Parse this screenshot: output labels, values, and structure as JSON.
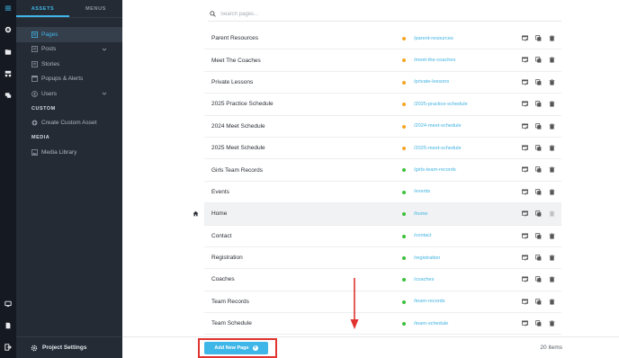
{
  "sidebar": {
    "tabs": [
      {
        "label": "ASSETS"
      },
      {
        "label": "MENUS"
      }
    ],
    "items": [
      {
        "label": "Pages"
      },
      {
        "label": "Posts"
      },
      {
        "label": "Stories"
      },
      {
        "label": "Popups & Alerts"
      },
      {
        "label": "Users"
      }
    ],
    "custom_header": "CUSTOM",
    "custom_items": [
      {
        "label": "Create Custom Asset"
      }
    ],
    "media_header": "MEDIA",
    "media_items": [
      {
        "label": "Media Library"
      }
    ],
    "footer_label": "Project Settings"
  },
  "search": {
    "placeholder": "Search pages..."
  },
  "pages": [
    {
      "title": "Parent Resources",
      "slug": "/parent-resources",
      "status": "draft"
    },
    {
      "title": "Meet The Coaches",
      "slug": "/meet-the-coaches",
      "status": "draft"
    },
    {
      "title": "Private Lessons",
      "slug": "/private-lessons",
      "status": "draft"
    },
    {
      "title": "2025 Practice Schedule",
      "slug": "/2025-practice-schedule",
      "status": "draft"
    },
    {
      "title": "2024 Meet Schedule",
      "slug": "/2024-meet-schedule",
      "status": "draft"
    },
    {
      "title": "2025 Meet Schedule",
      "slug": "/2025-meet-schedule",
      "status": "draft"
    },
    {
      "title": "Girls Team Records",
      "slug": "/girls-team-records",
      "status": "published"
    },
    {
      "title": "Events",
      "slug": "/events",
      "status": "published"
    },
    {
      "title": "Home",
      "slug": "/home",
      "status": "published"
    },
    {
      "title": "Contact",
      "slug": "/contact",
      "status": "published"
    },
    {
      "title": "Registration",
      "slug": "/registration",
      "status": "published"
    },
    {
      "title": "Coaches",
      "slug": "/coaches",
      "status": "published"
    },
    {
      "title": "Team Records",
      "slug": "/team-records",
      "status": "published"
    },
    {
      "title": "Team Schedule",
      "slug": "/team-schedule",
      "status": "published"
    }
  ],
  "footer": {
    "add_label": "Add New Page",
    "count": "20 items"
  },
  "colors": {
    "accent": "#3fb6e8",
    "draft": "#f5a623",
    "published": "#3cc13b",
    "highlight": "#e0332f"
  }
}
